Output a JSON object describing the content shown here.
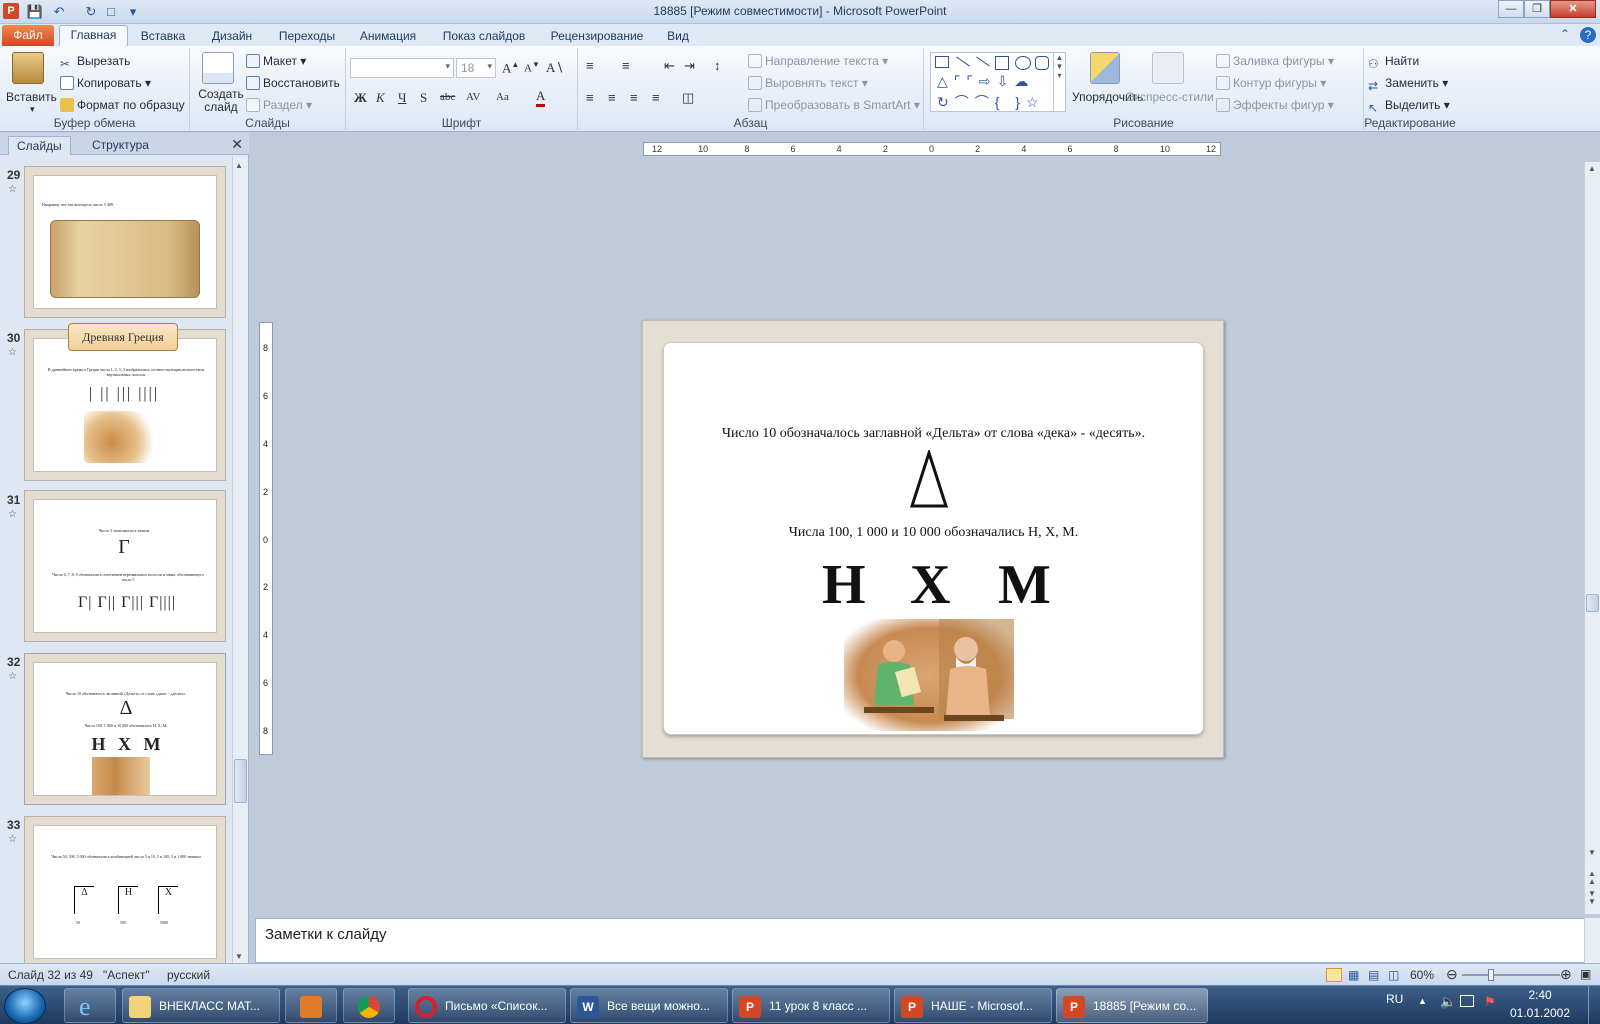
{
  "titlebar": {
    "title": "18885 [Режим совместимости] - Microsoft PowerPoint",
    "app_letter": "P"
  },
  "ribbon_tabs": [
    "Файл",
    "Главная",
    "Вставка",
    "Дизайн",
    "Переходы",
    "Анимация",
    "Показ слайдов",
    "Рецензирование",
    "Вид"
  ],
  "clipboard": {
    "paste": "Вставить",
    "cut": "Вырезать",
    "copy": "Копировать",
    "format_painter": "Формат по образцу",
    "group": "Буфер обмена"
  },
  "slides_group": {
    "new_slide": "Создать слайд",
    "layout": "Макет",
    "reset": "Восстановить",
    "section": "Раздел",
    "group": "Слайды"
  },
  "font_group": {
    "font_size": "18",
    "group": "Шрифт",
    "bold": "Ж",
    "italic": "К",
    "underline": "Ч",
    "shadow": "S",
    "strike": "abc",
    "spacing": "AV",
    "case": "Aa",
    "color": "A"
  },
  "paragraph_group": {
    "text_direction": "Направление текста",
    "align_text": "Выровнять текст",
    "smartart": "Преобразовать в SmartArt",
    "group": "Абзац"
  },
  "drawing_group": {
    "arrange": "Упорядочить",
    "quick_styles": "Экспресс-стили",
    "shape_fill": "Заливка фигуры",
    "shape_outline": "Контур фигуры",
    "shape_effects": "Эффекты фигур",
    "group": "Рисование"
  },
  "editing_group": {
    "find": "Найти",
    "replace": "Заменить",
    "select": "Выделить",
    "group": "Редактирование"
  },
  "left_pane": {
    "tab_slides": "Слайды",
    "tab_outline": "Структура",
    "thumbnails": [
      {
        "num": "29",
        "text1": "Например, вот так выглядело число 5 489:"
      },
      {
        "num": "30",
        "badge": "Древняя Греция",
        "text1": "В древнейшее время в Греции числа 1, 2, 3, 4 изображались соответствующим количеством вертикальных полосок",
        "glyphs": "| || ||| ||||"
      },
      {
        "num": "31",
        "text1": "Число 5 записывалось знаком",
        "glyph_main": "Г",
        "text2": "Числа 6, 7, 8, 9 обозначались сочетанием вертикальных полосок и знака, обозначающего число 5",
        "glyphs": "Г| Г|| Г||| Г||||"
      },
      {
        "num": "32",
        "text1": "Число 10 обозначалось заглавной «Дельта» от слова «дека» - «десять».",
        "glyph_main": "Δ",
        "text2": "Числа 100, 1 000 и 10 000 обозначались Н, Х, М.",
        "letters": "Н Х М"
      },
      {
        "num": "33",
        "text1": "Числа 50, 500, 5 000 обозначались комбинацией числа 5 и 10, 5 и 100, 5 и 1 000 значком",
        "marks": [
          "Δ",
          "Н",
          "Х"
        ],
        "values": [
          "50",
          "500",
          "5000"
        ]
      }
    ]
  },
  "slide": {
    "line1": "Число 10 обозначалось заглавной «Дельта» от слова «дека» - «десять».",
    "delta": "Δ",
    "line2": "Числа 100, 1 000 и 10 000 обозначались Н, Х, М.",
    "letters": [
      "Н",
      "Х",
      "М"
    ]
  },
  "ruler": {
    "h_ticks": [
      "12",
      "10",
      "8",
      "6",
      "4",
      "2",
      "0",
      "2",
      "4",
      "6",
      "8",
      "10",
      "12"
    ],
    "v_ticks": [
      "8",
      "6",
      "4",
      "2",
      "0",
      "2",
      "4",
      "6",
      "8"
    ]
  },
  "notes": {
    "placeholder": "Заметки к слайду"
  },
  "status": {
    "slide": "Слайд 32 из 49",
    "theme": "\"Аспект\"",
    "language": "русский",
    "zoom": "60%"
  },
  "taskbar": {
    "items": [
      {
        "label": "ВНЕКЛАСС МАТ..."
      },
      {
        "label": "Письмо «Список..."
      },
      {
        "label": "Все вещи можно..."
      },
      {
        "label": "11 урок   8 класс ..."
      },
      {
        "label": "НАШЕ - Microsof..."
      },
      {
        "label": "18885 [Режим со..."
      }
    ],
    "lang": "RU",
    "time": "2:40",
    "date": "01.01.2002"
  },
  "colors": {
    "file_tab": "#d24726",
    "selected_slide": "#f5c84c",
    "taskbar": "#1f3a60"
  }
}
